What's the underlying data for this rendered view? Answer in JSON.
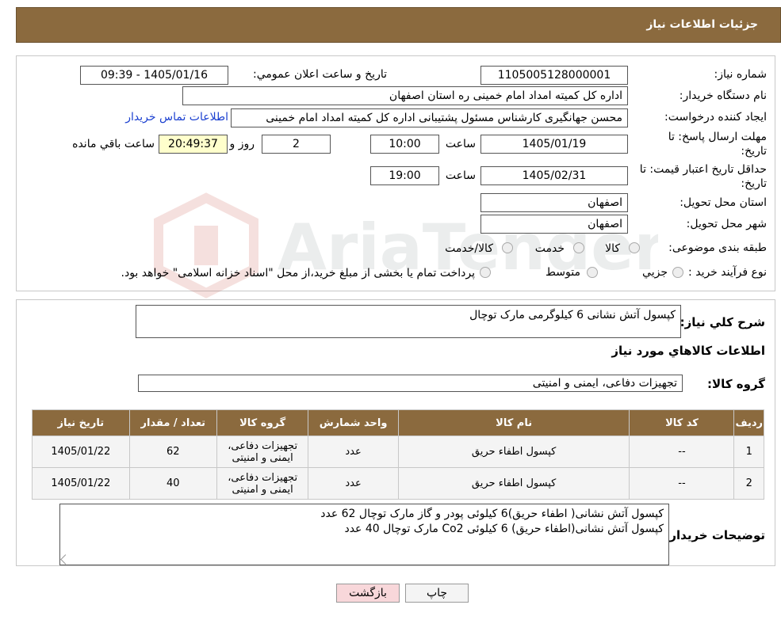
{
  "header": {
    "title": "جزئیات اطلاعات نیاز"
  },
  "form": {
    "need_number_label": "شماره نیاز:",
    "need_number": "1105005128000001",
    "announce_label": "تاریخ و ساعت اعلان عمومي:",
    "announce_value": "1405/01/16 - 09:39",
    "buyer_org_label": "نام دستگاه خریدار:",
    "buyer_org": "اداره کل کمیته امداد امام خمینی  ره  استان اصفهان",
    "creator_label": "ایجاد کننده درخواست:",
    "creator": "محسن جهانگیری کارشناس مسئول پشتیبانی اداره کل کمیته امداد امام خمینی",
    "contact_link": "اطلاعات تماس خریدار",
    "deadline_label_1": "مهلت ارسال پاسخ: تا",
    "deadline_label_2": "تاریخ:",
    "deadline_date": "1405/01/19",
    "time_label": "ساعت",
    "deadline_time": "10:00",
    "days": "2",
    "days_label": "روز و",
    "remaining_time": "20:49:37",
    "remaining_label": "ساعت باقي مانده",
    "validity_label_1": "حداقل تاریخ اعتبار قیمت: تا",
    "validity_label_2": "تاریخ:",
    "validity_date": "1405/02/31",
    "validity_time": "19:00",
    "province_label": "استان محل تحویل:",
    "province": "اصفهان",
    "city_label": "شهر محل تحویل:",
    "city": "اصفهان",
    "category_label": "طبقه بندی موضوعی:",
    "category_options": [
      "کالا",
      "خدمت",
      "کالا/خدمت"
    ],
    "process_label": "نوع فرآیند خرید :",
    "process_options": [
      "جزیي",
      "متوسط"
    ],
    "process_note": "پرداخت تمام یا بخشی از مبلغ خرید،از محل \"اسناد خزانه اسلامی\" خواهد بود."
  },
  "summary": {
    "label": "شرح کلي نياز:",
    "value": "کپسول آتش نشانی 6 کیلوگرمی مارک توچال"
  },
  "goods_info_title": "اطلاعات كالاهاي مورد نياز",
  "goods_group": {
    "label": "گروه کالا:",
    "value": "تجهیزات دفاعی، ایمنی و امنیتی"
  },
  "table": {
    "headers": [
      "رديف",
      "کد کالا",
      "نام کالا",
      "واحد شمارش",
      "گروه کالا",
      "تعداد / مقدار",
      "تاریخ نیاز"
    ],
    "rows": [
      [
        "1",
        "--",
        "کپسول اطفاء حریق",
        "عدد",
        "تجهیزات دفاعی، ایمنی و امنیتی",
        "62",
        "1405/01/22"
      ],
      [
        "2",
        "--",
        "کپسول اطفاء حریق",
        "عدد",
        "تجهیزات دفاعی، ایمنی و امنیتی",
        "40",
        "1405/01/22"
      ]
    ]
  },
  "buyer_notes": {
    "label": "توضیحات خریدار:",
    "line1": "کپسول آتش نشانی( اطفاء حریق)6 کیلوئی پودر و گاز مارک توچال 62 عدد",
    "line2": "کپسول آتش نشانی(اطفاء حریق) 6 کیلوئی Co2 مارک توچال 40 عدد"
  },
  "buttons": {
    "print": "چاپ",
    "back": "بازگشت"
  },
  "colors": {
    "header": "#8b6a3e",
    "link": "#1a3fd0",
    "back_button": "#f8d7da"
  }
}
